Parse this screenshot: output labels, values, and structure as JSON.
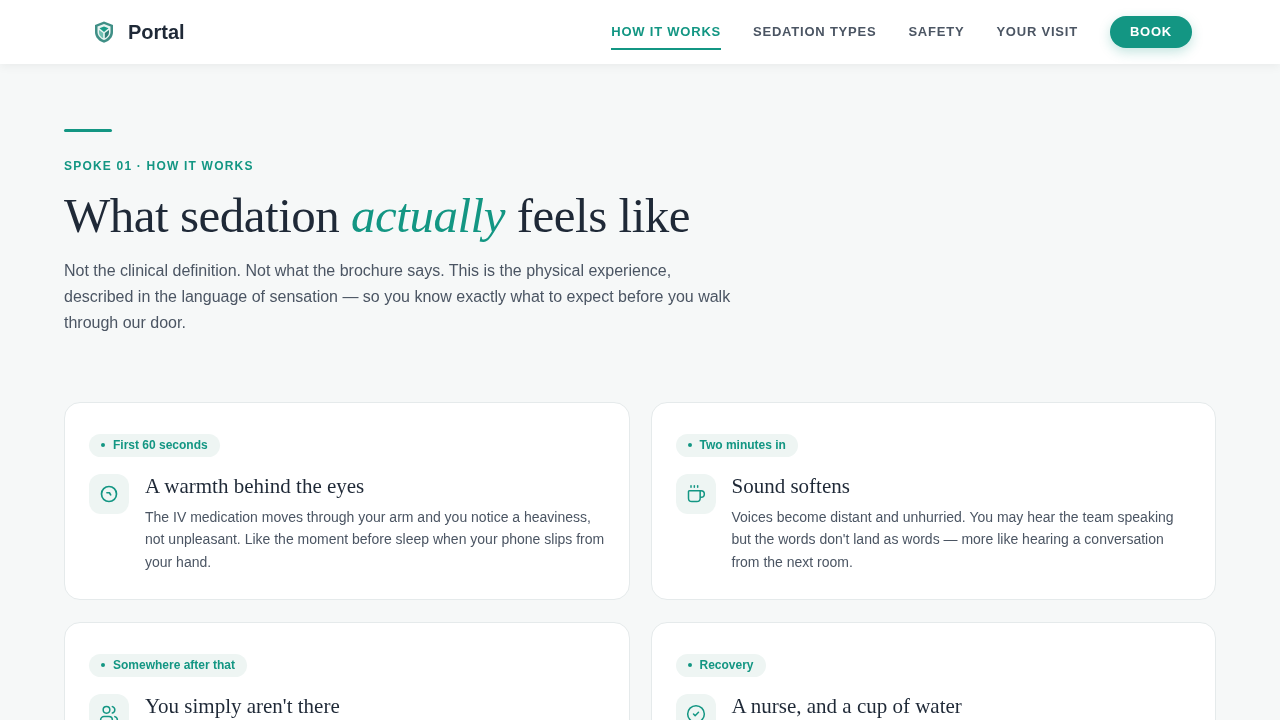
{
  "header": {
    "brand": "Portal",
    "nav": [
      {
        "label": "HOW IT WORKS",
        "selected": true
      },
      {
        "label": "SEDATION TYPES",
        "selected": false
      },
      {
        "label": "SAFETY",
        "selected": false
      },
      {
        "label": "YOUR VISIT",
        "selected": false
      }
    ],
    "cta": "BOOK"
  },
  "hero": {
    "eyebrow": "SPOKE 01 · HOW IT WORKS",
    "title": "What sedation *actually* feels like",
    "intro": "Not the clinical definition. Not what the brochure says. This is the physical experience, described in the language of sensation — so you know exactly what to expect before you walk through our door."
  },
  "cards": [
    {
      "tag": "First 60 seconds",
      "title": "A warmth behind the eyes",
      "body": "The IV medication moves through your arm and you notice a heaviness, not unpleasant. Like the moment before sleep when your phone slips from your hand."
    },
    {
      "tag": "Two minutes in",
      "title": "Sound softens",
      "body": "Voices become distant and unhurried. You may hear the team speaking but the words don't land as words — more like hearing a conversation from the next room."
    },
    {
      "tag": "Somewhere after that",
      "title": "You simply aren't there"
    },
    {
      "tag": "Recovery",
      "title": "A nurse, and a cup of water"
    }
  ]
}
